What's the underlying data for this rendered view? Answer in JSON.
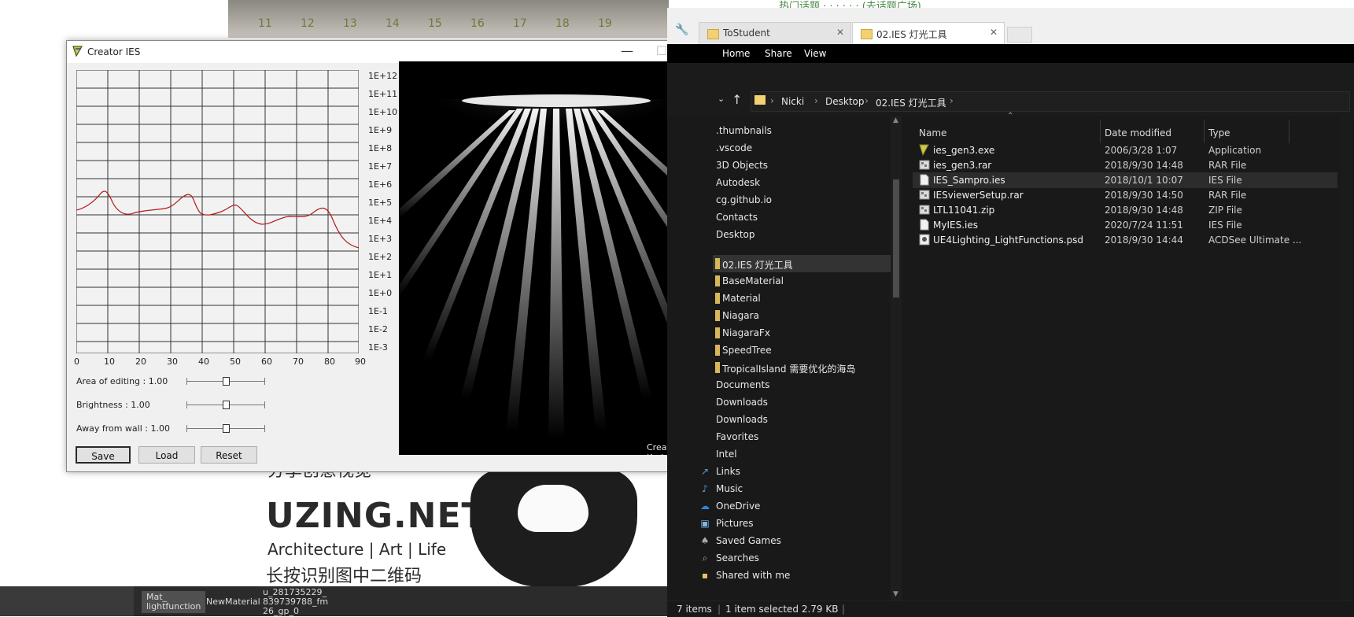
{
  "background_page": {
    "top_ticks": [
      "11",
      "12",
      "13",
      "14",
      "15",
      "16",
      "17",
      "18",
      "19"
    ],
    "top_text": "热门话题 · · · · · · (去话题广场)",
    "promo_faint": "分享创意视觉",
    "promo_title": "UZING.NET",
    "promo_sub": "Architecture | Art | Life",
    "promo_cn": "长按识别图中二维码",
    "bottom_tags": [
      "Mat_\nlightfunction",
      "NewMaterial",
      "u_281735229_\n839739788_fm\n26_gp_0"
    ]
  },
  "ies_window": {
    "title": "Creator IES",
    "controls": {
      "minimize": "—",
      "maximize": "☐",
      "close": "✕"
    },
    "y_labels": [
      "1E+12",
      "1E+11",
      "1E+10",
      "1E+9",
      "1E+8",
      "1E+7",
      "1E+6",
      "1E+5",
      "1E+4",
      "1E+3",
      "1E+2",
      "1E+1",
      "1E+0",
      "1E-1",
      "1E-2",
      "1E-3"
    ],
    "x_labels": [
      "0",
      "10",
      "20",
      "30",
      "40",
      "50",
      "60",
      "70",
      "80",
      "90"
    ],
    "params": [
      {
        "label": "Area of editing :  1.00",
        "value": 0.5
      },
      {
        "label": "Brightness :  1.00",
        "value": 0.5
      },
      {
        "label": "Away from wall :  1.00",
        "value": 0.5
      }
    ],
    "buttons": {
      "save": "Save",
      "load": "Load",
      "reset": "Reset"
    },
    "credit": "Created by Karba",
    "curve_color": "#b11a1a"
  },
  "explorer": {
    "tabs": [
      {
        "label": "ToStudent"
      },
      {
        "label": "02.IES 灯光工具"
      }
    ],
    "ribbon": [
      "Home",
      "Share",
      "View"
    ],
    "breadcrumb": [
      "Nicki",
      "Desktop",
      "02.IES 灯光工具"
    ],
    "nav_items": [
      ".thumbnails",
      ".vscode",
      "3D Objects",
      "Autodesk",
      "cg.github.io",
      "Contacts",
      "Desktop",
      "02.IES 灯光工具",
      "BaseMaterial",
      "Material",
      "Niagara",
      "NiagaraFx",
      "SpeedTree",
      "TropicalIsland 需要优化的海岛",
      "Documents",
      "Downloads",
      "Downloads",
      "Favorites",
      "Intel",
      "Links",
      "Music",
      "OneDrive",
      "Pictures",
      "Saved Games",
      "Searches",
      "Shared with me"
    ],
    "columns": {
      "name": "Name",
      "date": "Date modified",
      "type": "Type"
    },
    "files": [
      {
        "name": "ies_gen3.exe",
        "date": "2006/3/28 1:07",
        "type": "Application",
        "icon": "exe-icon"
      },
      {
        "name": "ies_gen3.rar",
        "date": "2018/9/30 14:48",
        "type": "RAR File",
        "icon": "archive-icon"
      },
      {
        "name": "IES_Sampro.ies",
        "date": "2018/10/1 10:07",
        "type": "IES File",
        "icon": "file-icon"
      },
      {
        "name": "IESviewerSetup.rar",
        "date": "2018/9/30 14:50",
        "type": "RAR File",
        "icon": "archive-icon"
      },
      {
        "name": "LTL11041.zip",
        "date": "2018/9/30 14:48",
        "type": "ZIP File",
        "icon": "archive-icon"
      },
      {
        "name": "MyIES.ies",
        "date": "2020/7/24 11:51",
        "type": "IES File",
        "icon": "file-icon"
      },
      {
        "name": "UE4Lighting_LightFunctions.psd",
        "date": "2018/9/30 14:44",
        "type": "ACDSee Ultimate ...",
        "icon": "image-file-icon"
      }
    ],
    "status": {
      "items": "7 items",
      "selected": "1 item selected  2.79 KB"
    }
  }
}
